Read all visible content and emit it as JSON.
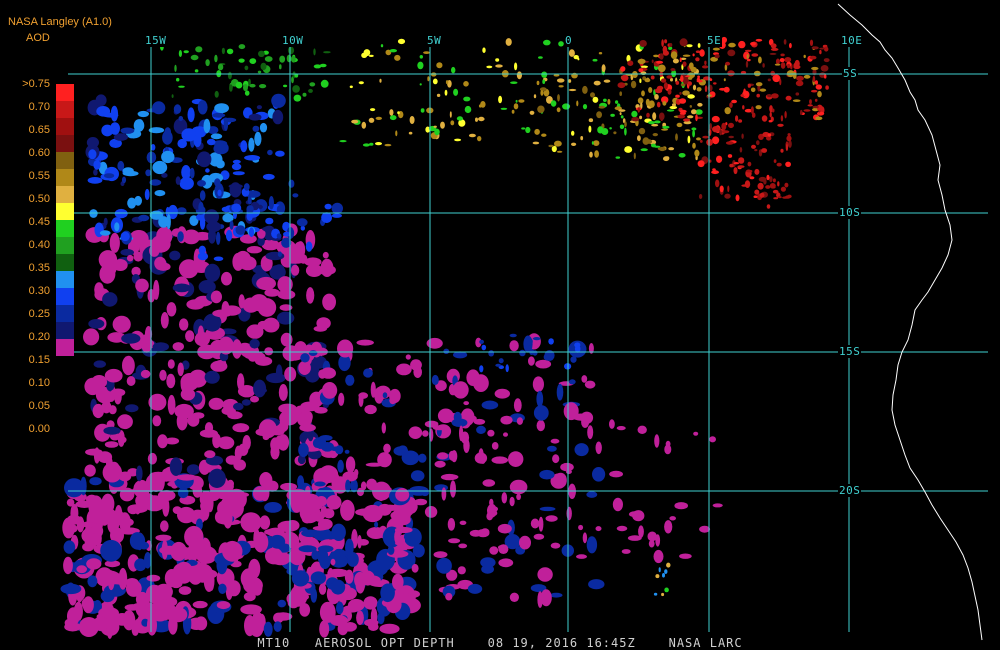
{
  "header": {
    "title": "NASA Langley (A1.0)",
    "product": "AOD"
  },
  "map": {
    "lon_labels": [
      "15W",
      "10W",
      "5W",
      "0",
      "5E",
      "10E"
    ],
    "lat_labels": [
      "5S",
      "10S",
      "15S",
      "20S"
    ],
    "grid_color": "#40d0d0",
    "coast_color": "#ffffff"
  },
  "legend": {
    "labels": [
      ">0.75",
      "0.70",
      "0.65",
      "0.60",
      "0.55",
      "0.50",
      "0.45",
      "0.40",
      "0.35",
      "0.30",
      "0.25",
      "0.20",
      "0.15",
      "0.10",
      "0.05",
      "0.00"
    ],
    "colors": [
      "#ff2020",
      "#c81818",
      "#a01010",
      "#7a1010",
      "#806010",
      "#b08818",
      "#e0b040",
      "#ffff30",
      "#20d020",
      "#20a020",
      "#106010",
      "#2090f0",
      "#1040f0",
      "#0a2aa0",
      "#101870",
      "#c0209a"
    ]
  },
  "caption": "MT10   AEROSOL OPT DEPTH    08 19, 2016 16:45Z    NASA LARC"
}
